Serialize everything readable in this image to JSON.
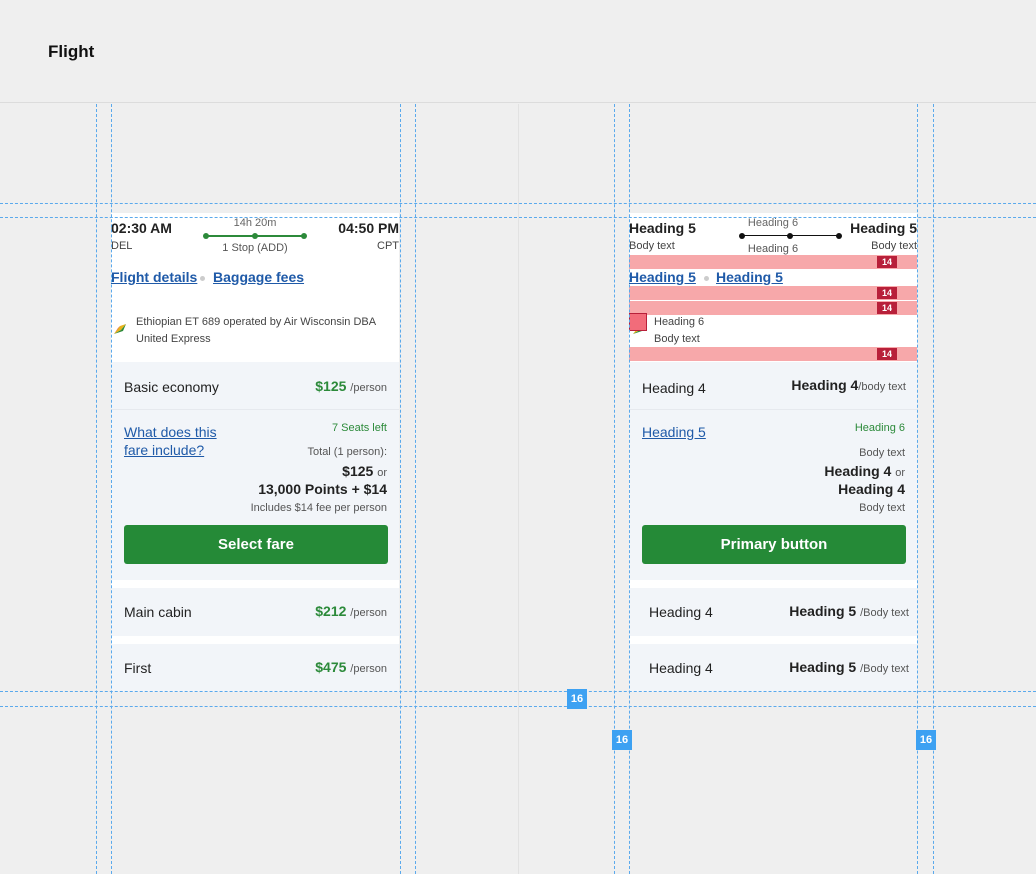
{
  "page": {
    "title": "Flight"
  },
  "spacing": {
    "gutter": "16",
    "padding": "14"
  },
  "left": {
    "depart_time": "02:30 AM",
    "depart_code": "DEL",
    "arrive_time": "04:50 PM",
    "arrive_code": "CPT",
    "duration": "14h 20m",
    "stops": "1 Stop (ADD)",
    "link_details": "Flight details",
    "link_baggage": "Baggage fees",
    "airline_line1": "Ethiopian  ET 689  operated by Air Wisconsin DBA",
    "airline_line2": "United Express",
    "fare1_name": "Basic economy",
    "fare1_price": "$125",
    "fare1_per": "/person",
    "question_line1": "What does this",
    "question_line2": "fare include?",
    "seats_left": "7 Seats left",
    "total_label": "Total (1 person):",
    "price_cash": "$125",
    "or": "or",
    "price_points": "13,000 Points + $14",
    "fee_note": "Includes $14 fee per person",
    "select_button": "Select fare",
    "fare2_name": "Main cabin",
    "fare2_price": "$212",
    "fare2_per": "/person",
    "fare3_name": "First",
    "fare3_price": "$475",
    "fare3_per": "/person"
  },
  "right": {
    "h5_left": "Heading 5",
    "body_left": "Body text",
    "h5_right": "Heading 5",
    "body_right": "Body text",
    "h6_top": "Heading 6",
    "h6_bottom": "Heading 6",
    "link1": "Heading 5",
    "link2": "Heading 5",
    "airline_heading": "Heading 6",
    "airline_body": "Body text",
    "fare1_name": "Heading 4",
    "fare1_price": "Heading 4",
    "fare1_per": "/body text",
    "link_h5": "Heading 5",
    "h6_green": "Heading 6",
    "body_a": "Body text",
    "h4_a": "Heading 4",
    "or": "or",
    "h4_b": "Heading 4",
    "body_b": "Body text",
    "primary_button": "Primary button",
    "fare2_name": "Heading 4",
    "fare2_price": "Heading 5",
    "fare2_per": "/Body text",
    "fare3_name": "Heading 4",
    "fare3_price": "Heading 5",
    "fare3_per": "/Body text"
  },
  "colors": {
    "accent_green": "#258a37",
    "link_blue": "#1f5aa8",
    "guide_blue": "#3da1f2",
    "spacing_red": "#f7a8aa"
  }
}
